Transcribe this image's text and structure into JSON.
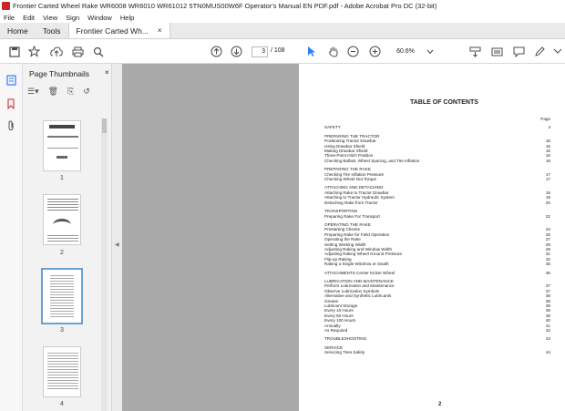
{
  "window": {
    "title": "Frontier Carted Wheel Rake WR6008 WR6010 WR61012 5TN0MUS00W6F Operator's Manual EN PDF.pdf - Adobe Acrobat Pro DC (32-bit)"
  },
  "menu": [
    "File",
    "Edit",
    "View",
    "Sign",
    "Window",
    "Help"
  ],
  "tabs": {
    "home": "Home",
    "tools": "Tools",
    "document": "Frontier Carted Wh...",
    "close": "×"
  },
  "toolbar": {
    "page_current": "3",
    "page_total": "/ 108",
    "zoom": "60.6%"
  },
  "panel": {
    "title": "Page Thumbnails",
    "close": "×"
  },
  "thumbnails": [
    {
      "label": "1"
    },
    {
      "label": "2"
    },
    {
      "label": "3"
    },
    {
      "label": "4"
    }
  ],
  "document": {
    "toc_title": "TABLE OF CONTENTS",
    "page_header": "Page",
    "page_number": "2",
    "sections": [
      {
        "heading": "SAFETY",
        "page": "4",
        "items": []
      },
      {
        "heading": "PREPARING THE TRACTOR",
        "page": "",
        "items": [
          {
            "text": "Positioning Tractor Drawbar",
            "page": "15"
          },
          {
            "text": "Using Drawbar Shield",
            "page": "15"
          },
          {
            "text": "Making Drawbar Shield",
            "page": "16"
          },
          {
            "text": "Three-Point Hitch Position",
            "page": "16"
          },
          {
            "text": "Checking Ballast, Wheel Spacing, and Tire Inflation",
            "page": "16"
          }
        ]
      },
      {
        "heading": "PREPARING THE RAKE",
        "page": "",
        "items": [
          {
            "text": "Checking Tire Inflation Pressure",
            "page": "17"
          },
          {
            "text": "Checking Wheel Nut Torque",
            "page": "17"
          }
        ]
      },
      {
        "heading": "ATTACHING AND DETACHING",
        "page": "",
        "items": [
          {
            "text": "Attaching Rake to Tractor Drawbar",
            "page": "18"
          },
          {
            "text": "Attaching to Tractor Hydraulic System",
            "page": "19"
          },
          {
            "text": "Detaching Rake from Tractor",
            "page": "20"
          }
        ]
      },
      {
        "heading": "TRANSPORTING",
        "page": "",
        "items": [
          {
            "text": "Preparing Rake For Transport",
            "page": "22"
          }
        ]
      },
      {
        "heading": "OPERATING THE RAKE",
        "page": "",
        "items": [
          {
            "text": "Prestarting Checks",
            "page": "24"
          },
          {
            "text": "Preparing Rake for Field Operation",
            "page": "25"
          },
          {
            "text": "Operating the Rake",
            "page": "27"
          },
          {
            "text": "Setting Working Width",
            "page": "28"
          },
          {
            "text": "Adjusting Raking and Window Width",
            "page": "29"
          },
          {
            "text": "Adjusting Raking Wheel Ground Pressure",
            "page": "31"
          },
          {
            "text": "Flip-up Raking",
            "page": "32"
          },
          {
            "text": "Raking a Single Windrow or Swath",
            "page": "35"
          }
        ]
      },
      {
        "heading": "ATTACHMENTS Center Kicker Wheel",
        "page": "36",
        "items": []
      },
      {
        "heading": "LUBRICATION AND MAINTENANCE",
        "page": "",
        "items": [
          {
            "text": "Perform Lubrication and Maintenance",
            "page": "37"
          },
          {
            "text": "Observe Lubrication Symbols",
            "page": "37"
          },
          {
            "text": "Alternative and Synthetic Lubricants",
            "page": "38"
          },
          {
            "text": "Grease",
            "page": "38"
          },
          {
            "text": "Lubricant Storage",
            "page": "39"
          },
          {
            "text": "Every 10 Hours",
            "page": "39"
          },
          {
            "text": "Every 50 Hours",
            "page": "39"
          },
          {
            "text": "Every 100 Hours",
            "page": "40"
          },
          {
            "text": "Annually",
            "page": "41"
          },
          {
            "text": "As Required",
            "page": "42"
          }
        ]
      },
      {
        "heading": "TROUBLESHOOTING",
        "page": "43",
        "items": []
      },
      {
        "heading": "SERVICE",
        "page": "",
        "items": [
          {
            "text": "Servicing Tires Safely",
            "page": "44"
          }
        ]
      }
    ]
  },
  "colors": {
    "accent_red": "#c9252c",
    "select_blue": "#2d7ff9",
    "viewer_bg": "#a9a9a9"
  }
}
